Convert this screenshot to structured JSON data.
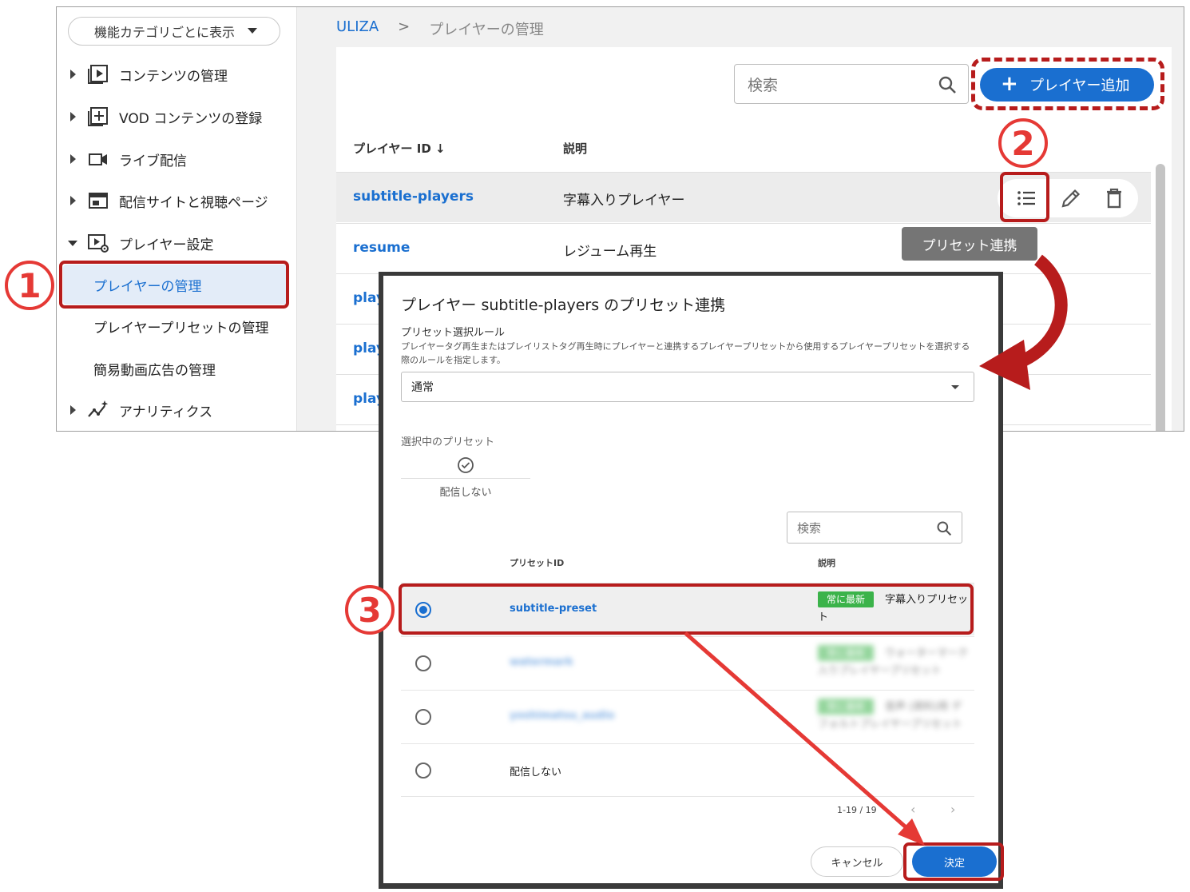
{
  "sidebar": {
    "view_toggle": "機能カテゴリごとに表示",
    "items": [
      {
        "label": "コンテンツの管理"
      },
      {
        "label": "VOD コンテンツの登録"
      },
      {
        "label": "ライブ配信"
      },
      {
        "label": "配信サイトと視聴ページ"
      },
      {
        "label": "プレイヤー設定"
      },
      {
        "label": "アナリティクス"
      }
    ],
    "sub_items": [
      {
        "label": "プレイヤーの管理"
      },
      {
        "label": "プレイヤープリセットの管理"
      },
      {
        "label": "簡易動画広告の管理"
      }
    ]
  },
  "breadcrumb": {
    "root": "ULIZA",
    "separator": ">",
    "current": "プレイヤーの管理"
  },
  "toolbar": {
    "search_placeholder": "検索",
    "add_label": "プレイヤー追加"
  },
  "table": {
    "headers": {
      "id": "プレイヤー ID",
      "sort_arrow": "↓",
      "desc": "説明"
    },
    "rows": [
      {
        "id": "subtitle-players",
        "desc": "字幕入りプレイヤー"
      },
      {
        "id": "resume",
        "desc": "レジューム再生"
      },
      {
        "id": "play"
      },
      {
        "id": "play"
      },
      {
        "id": "play"
      }
    ]
  },
  "tooltip": "プリセット連携",
  "dialog": {
    "title": "プレイヤー subtitle-players のプリセット連携",
    "rule_label": "プリセット選択ルール",
    "rule_help": "プレイヤータグ再生またはプレイリストタグ再生時にプレイヤーと連携するプレイヤープリセットから使用するプレイヤープリセットを選択する際のルールを指定します。",
    "rule_value": "通常",
    "selected_label": "選択中のプリセット",
    "selected_value": "配信しない",
    "search_placeholder": "検索",
    "headers": {
      "id": "プリセットID",
      "desc": "説明"
    },
    "rows": [
      {
        "id": "subtitle-preset",
        "tag": "常に最新",
        "desc": "字幕入りプリセット"
      },
      {
        "id": "watermark",
        "tag": "常に最新",
        "desc": "ウォーターマーク入りプレイヤープリセット"
      },
      {
        "id": "yoshimatsu_audio",
        "tag": "常に最新",
        "desc": "音声 (資料)用 デフォルトプレイヤープリセット"
      },
      {
        "id": "配信しない"
      }
    ],
    "pager": "1-19 / 19",
    "prev": "‹",
    "next": "›",
    "cancel_label": "キャンセル",
    "ok_label": "決定"
  },
  "annotations": {
    "step1": "1",
    "step2": "2",
    "step3": "3"
  },
  "colors": {
    "accent": "#1a6fd0",
    "annotation_red": "#b71c1c",
    "arrow_red": "#e53935",
    "tag_green": "#3bb34a"
  }
}
